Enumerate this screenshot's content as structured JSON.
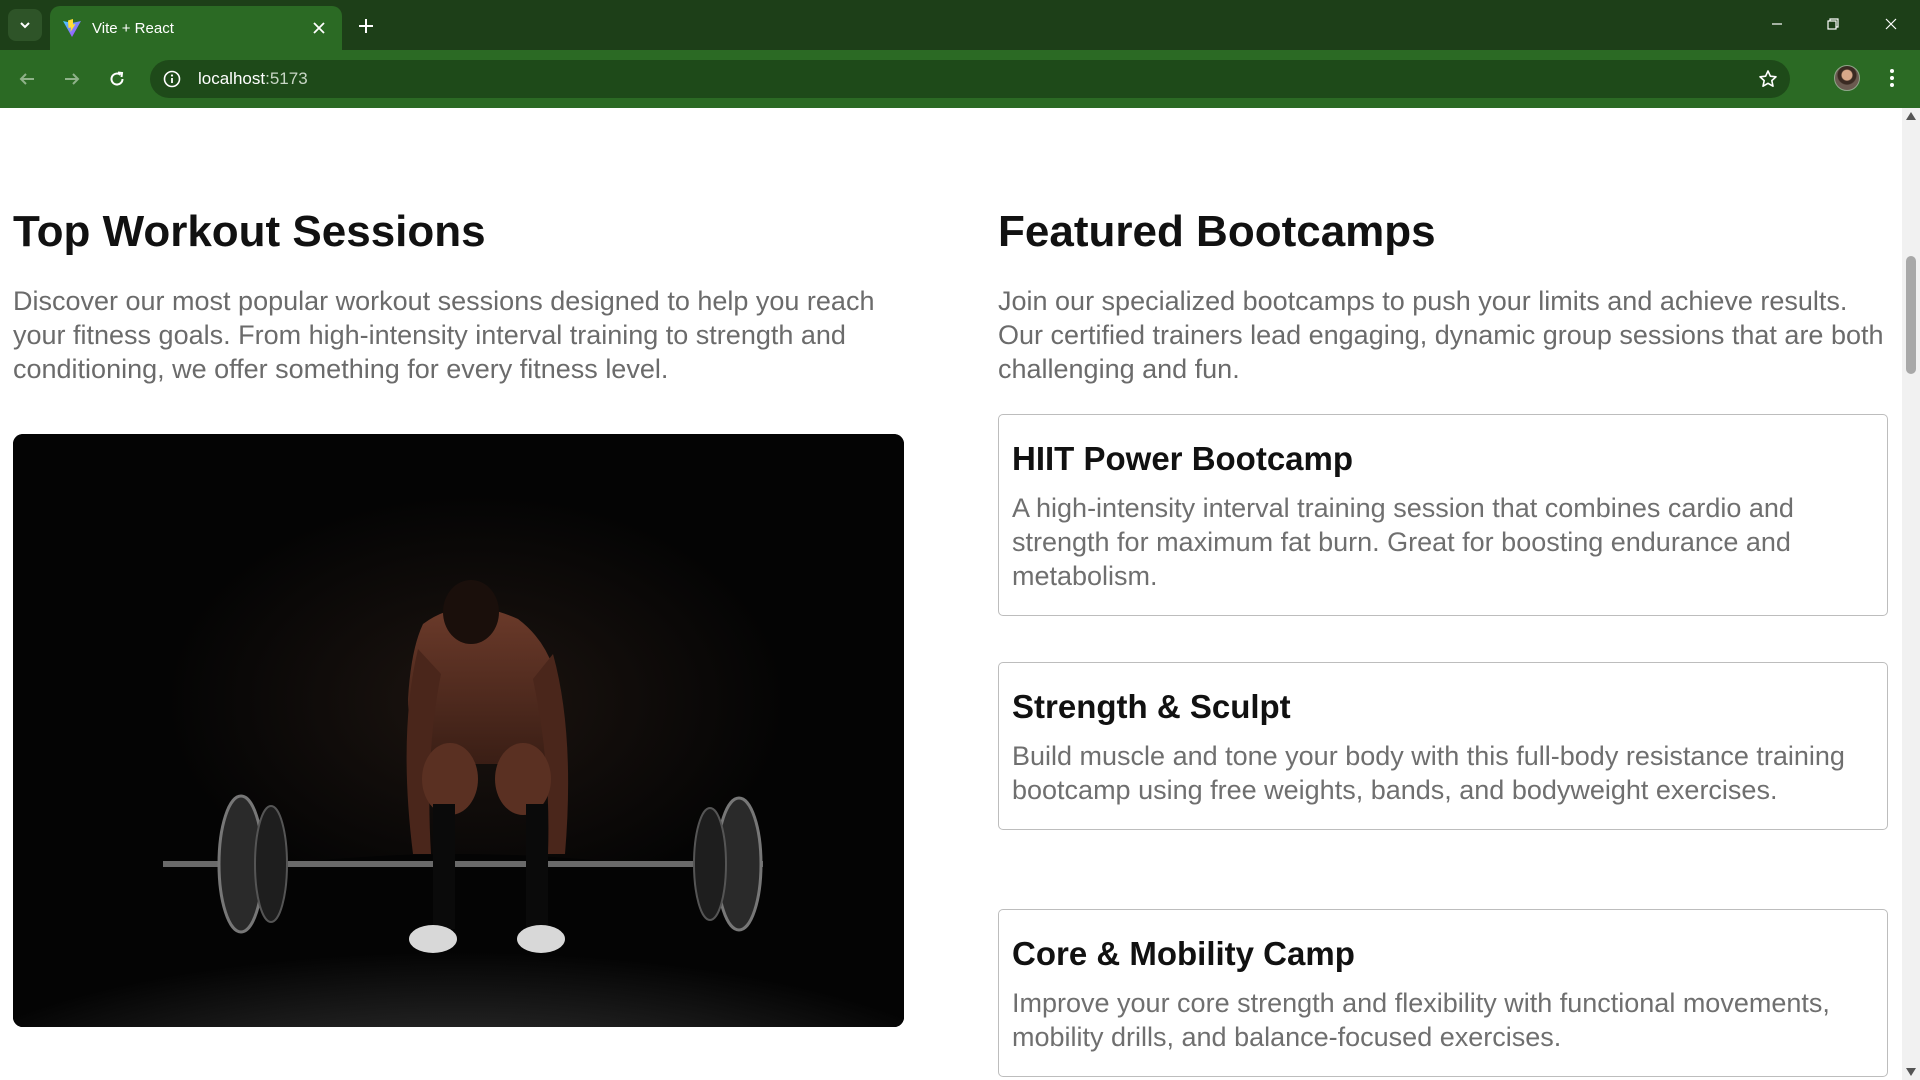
{
  "browser": {
    "tab_title": "Vite + React",
    "url_host": "localhost",
    "url_port": ":5173"
  },
  "page": {
    "workouts": {
      "title": "Top Workout Sessions",
      "description": "Discover our most popular workout sessions designed to help you reach your fitness goals. From high-intensity interval training to strength and conditioning, we offer something for every fitness level."
    },
    "bootcamps": {
      "title": "Featured Bootcamps",
      "description": "Join our specialized bootcamps to push your limits and achieve results. Our certified trainers lead engaging, dynamic group sessions that are both challenging and fun.",
      "items": [
        {
          "title": "HIIT Power Bootcamp",
          "description": "A high-intensity interval training session that combines cardio and strength for maximum fat burn. Great for boosting endurance and metabolism."
        },
        {
          "title": "Strength & Sculpt",
          "description": "Build muscle and tone your body with this full-body resistance training bootcamp using free weights, bands, and bodyweight exercises."
        },
        {
          "title": "Core & Mobility Camp",
          "description": "Improve your core strength and flexibility with functional movements, mobility drills, and balance-focused exercises."
        }
      ]
    }
  },
  "colors": {
    "chrome_dark": "#1d3f18",
    "chrome_accent": "#2b6a24",
    "heading": "#111111",
    "body_text": "#6b6b6b"
  },
  "icons": {
    "tab_search": "chevron-down-icon",
    "favicon": "vite-logo-icon",
    "tab_close": "close-icon",
    "new_tab": "plus-icon",
    "minimize": "minimize-icon",
    "restore": "restore-icon",
    "close_window": "close-icon",
    "back": "arrow-left-icon",
    "forward": "arrow-right-icon",
    "reload": "reload-icon",
    "site_info": "info-icon",
    "bookmark": "star-icon",
    "menu": "kebab-menu-icon"
  }
}
